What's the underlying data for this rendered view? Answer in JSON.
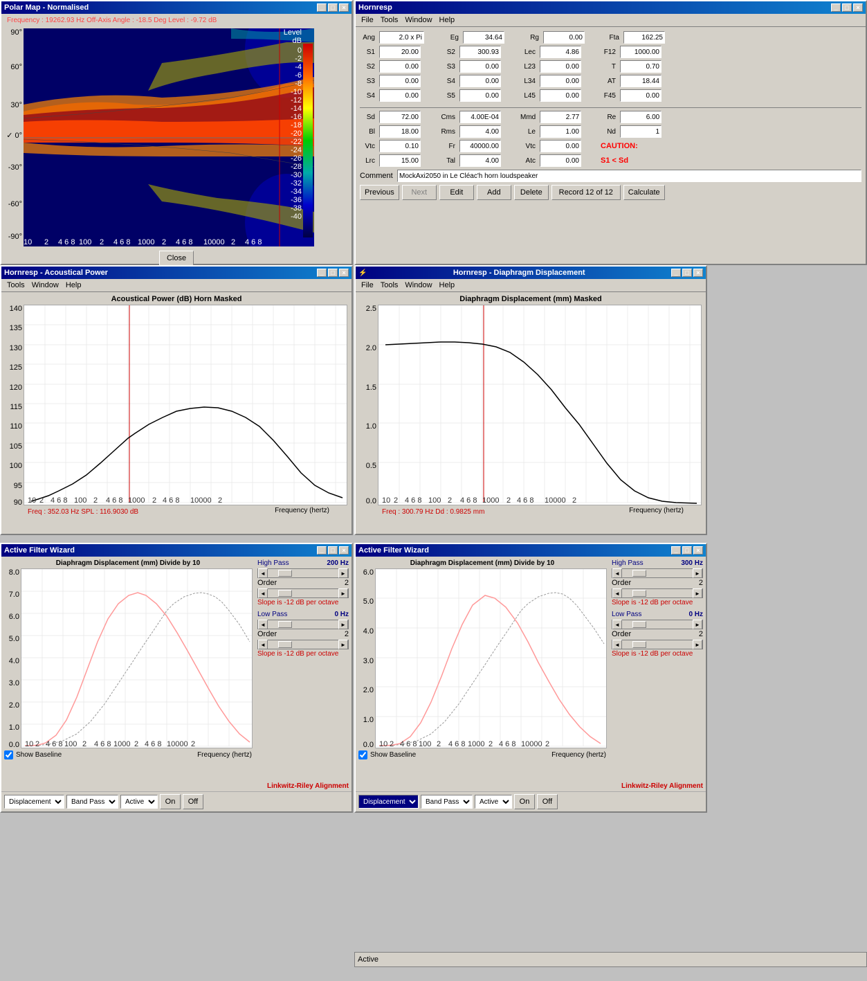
{
  "polar_map": {
    "title": "Polar Map - Normalised",
    "info": "Frequency : 19262.93 Hz    Off-Axis Angle : -18.5 Deg    Level : -9.72 dB",
    "close_btn": "Close",
    "colorbar_label": "Level  dB",
    "colorbar_values": [
      "0",
      "-2",
      "-4",
      "-6",
      "-8",
      "-10",
      "-12",
      "-14",
      "-16",
      "-18",
      "-20",
      "-22",
      "-24",
      "-26",
      "-28",
      "-30",
      "-32",
      "-34",
      "-36",
      "-38",
      "-40"
    ]
  },
  "hornresp": {
    "title": "Hornresp",
    "menus": [
      "File",
      "Tools",
      "Window",
      "Help"
    ],
    "params": {
      "ang_label": "Ang",
      "ang_value": "2.0 x Pi",
      "eg_label": "Eg",
      "eg_value": "34.64",
      "rg_label": "Rg",
      "rg_value": "0.00",
      "fta_label": "Fta",
      "fta_value": "162.25",
      "s1_label": "S1",
      "s1_value": "20.00",
      "s2_label": "S2",
      "s2_value": "300.93",
      "lec_label": "Lec",
      "lec_value": "4.86",
      "f12_label": "F12",
      "f12_value": "1000.00",
      "s2r_label": "S2",
      "s2r_value": "0.00",
      "s3_label": "S3",
      "s3_value": "0.00",
      "l23_label": "L23",
      "l23_value": "0.00",
      "t_label": "T",
      "t_value": "0.70",
      "s3r_label": "S3",
      "s3r_value": "0.00",
      "s4_label": "S4",
      "s4_value": "0.00",
      "l34_label": "L34",
      "l34_value": "0.00",
      "at_label": "AT",
      "at_value": "18.44",
      "s4r_label": "S4",
      "s4r_value": "0.00",
      "s5_label": "S5",
      "s5_value": "0.00",
      "l45_label": "L45",
      "l45_value": "0.00",
      "f45_label": "F45",
      "f45_value": "0.00",
      "sd_label": "Sd",
      "sd_value": "72.00",
      "cms_label": "Cms",
      "cms_value": "4.00E-04",
      "mmd_label": "Mmd",
      "mmd_value": "2.77",
      "re_label": "Re",
      "re_value": "6.00",
      "bl_label": "Bl",
      "bl_value": "18.00",
      "rms_label": "Rms",
      "rms_value": "4.00",
      "le_label": "Le",
      "le_value": "1.00",
      "nd_label": "Nd",
      "nd_value": "1",
      "vtc_label": "Vtc",
      "vtc_value": "0.10",
      "fr_label": "Fr",
      "fr_value": "40000.00",
      "vtc2_label": "Vtc",
      "vtc2_value": "0.00",
      "caution": "CAUTION:",
      "caution_sub": "S1 < Sd",
      "lrc_label": "Lrc",
      "lrc_value": "15.00",
      "tal_label": "Tal",
      "tal_value": "4.00",
      "atc_label": "Atc",
      "atc_value": "0.00"
    },
    "comment_label": "Comment",
    "comment_value": "MockAxi2050 in Le Cléac'h horn loudspeaker",
    "buttons": {
      "previous": "Previous",
      "next": "Next",
      "edit": "Edit",
      "add": "Add",
      "delete": "Delete",
      "record": "Record 12 of 12",
      "calculate": "Calculate"
    }
  },
  "acoustical_power": {
    "title": "Hornresp - Acoustical Power",
    "menus": [
      "Tools",
      "Window",
      "Help"
    ],
    "chart_title": "Acoustical Power (dB)   Horn  Masked",
    "freq_info": "Freq : 352.03 Hz    SPL : 116.9030 dB",
    "x_label": "Frequency (hertz)",
    "y_min": 90,
    "y_max": 140,
    "y_ticks": [
      90,
      95,
      100,
      105,
      110,
      115,
      120,
      125,
      130,
      135,
      140
    ]
  },
  "diaphragm_displacement": {
    "title": "Hornresp - Diaphragm Displacement",
    "menus": [
      "File",
      "Tools",
      "Window",
      "Help"
    ],
    "chart_title": "Diaphragm Displacement (mm)   Masked",
    "freq_info": "Freq : 300.79 Hz    Dd : 0.9825 mm",
    "x_label": "Frequency (hertz)",
    "y_min": 0.0,
    "y_max": 2.5,
    "y_ticks": [
      0.0,
      0.5,
      1.0,
      1.5,
      2.0,
      2.5
    ]
  },
  "active_filter_left": {
    "title": "Active Filter Wizard",
    "chart_title": "Diaphragm Displacement (mm)   Divide by 10",
    "high_pass_label": "High Pass",
    "high_pass_value": "200 Hz",
    "order_label": "Order",
    "order_value": "2",
    "slope_hp": "Slope is -12 dB per octave",
    "low_pass_label": "Low Pass",
    "low_pass_value": "0 Hz",
    "order2_label": "Order",
    "order2_value": "2",
    "slope_lp": "Slope is -12 dB per octave",
    "show_baseline": "Show Baseline",
    "freq_label": "Frequency (hertz)",
    "alignment": "Linkwitz-Riley Alignment",
    "dropdown1": "Displacement",
    "dropdown2": "Band Pass",
    "dropdown3": "Active",
    "btn_on": "On",
    "btn_off": "Off",
    "y_ticks": [
      "0.0",
      "1.0",
      "2.0",
      "3.0",
      "4.0",
      "5.0",
      "6.0",
      "7.0",
      "8.0"
    ]
  },
  "active_filter_right": {
    "title": "Active Filter Wizard",
    "chart_title": "Diaphragm Displacement (mm)   Divide by 10",
    "high_pass_label": "High Pass",
    "high_pass_value": "300 Hz",
    "order_label": "Order",
    "order_value": "2",
    "slope_hp": "Slope is -12 dB per octave",
    "low_pass_label": "Low Pass",
    "low_pass_value": "0 Hz",
    "order2_label": "Order",
    "order2_value": "2",
    "slope_lp": "Slope is -12 dB per octave",
    "show_baseline": "Show Baseline",
    "freq_label": "Frequency (hertz)",
    "alignment": "Linkwitz-Riley Alignment",
    "dropdown1": "Displacement",
    "dropdown2": "Band Pass",
    "dropdown3": "Active",
    "btn_on": "On",
    "btn_off": "Off",
    "y_ticks": [
      "0.0",
      "1.0",
      "2.0",
      "3.0",
      "4.0",
      "5.0",
      "6.0"
    ]
  }
}
